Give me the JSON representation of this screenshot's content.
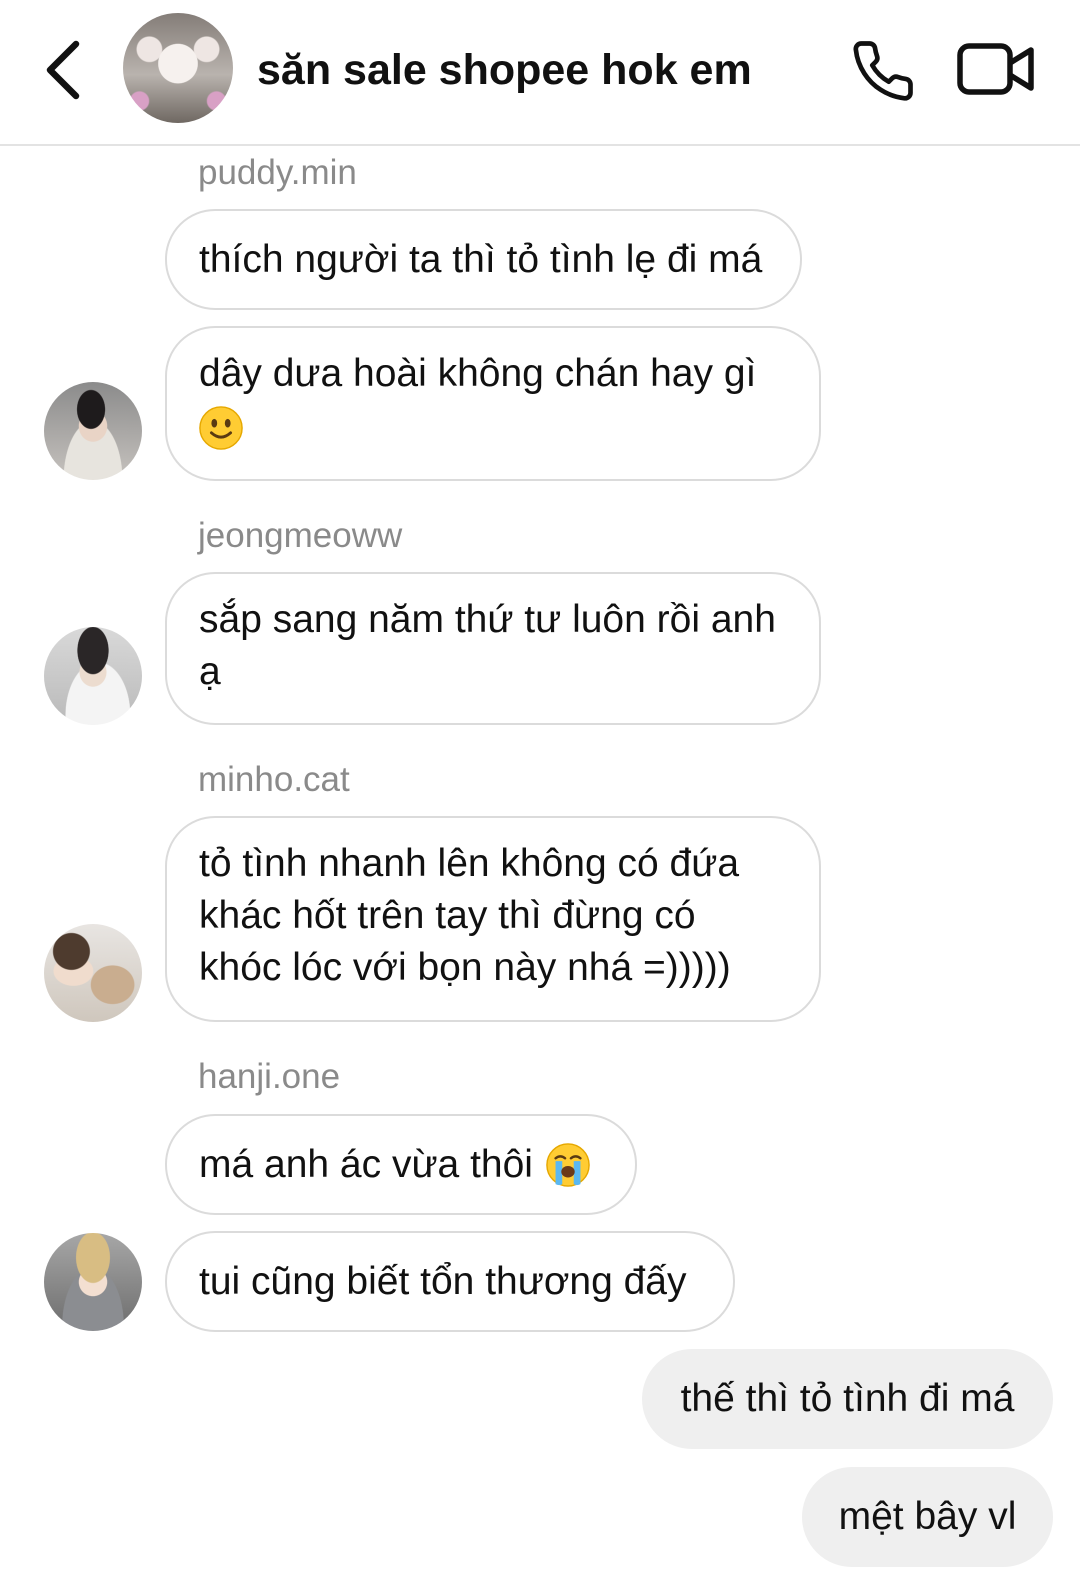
{
  "header": {
    "title": "săn sale shopee hok em",
    "icons": [
      "back-icon",
      "group-avatar",
      "phone-icon",
      "video-camera-icon"
    ]
  },
  "messages": [
    {
      "sender": "puddy.min",
      "lines": [
        "thích người ta thì tỏ tình lẹ đi má",
        "dây dưa hoài không chán hay gì"
      ],
      "emoji": "slightly-smiling-face"
    },
    {
      "sender": "jeongmeoww",
      "lines": [
        "sắp sang năm thứ tư luôn rồi anh",
        "ạ"
      ]
    },
    {
      "sender": "minho.cat",
      "lines": [
        "tỏ tình nhanh lên không có đứa",
        "khác hốt trên tay thì đừng có",
        "khóc lóc với bọn này nhá =)))))"
      ]
    },
    {
      "sender": "hanji.one",
      "lines": [
        "má anh ác vừa thôi",
        "tui cũng biết tổn thương đấy"
      ],
      "emoji": "loudly-crying-face"
    }
  ],
  "outgoing": [
    "thế thì tỏ tình đi má",
    "mệt bây vl"
  ],
  "colors": {
    "incoming_border": "#dbdbdb",
    "outgoing_bg": "#efefef",
    "username": "#8a8a8a"
  }
}
